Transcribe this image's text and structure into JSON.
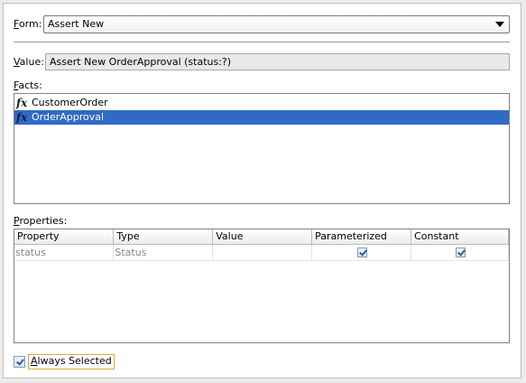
{
  "form": {
    "label_key": "F",
    "label_rest": "orm:",
    "selected": "Assert New"
  },
  "value": {
    "label_key": "V",
    "label_rest": "alue:",
    "text": "Assert New OrderApproval (status:?)"
  },
  "facts": {
    "label_key": "F",
    "label_rest": "acts:",
    "items": [
      {
        "label": "CustomerOrder",
        "icon": "function-icon",
        "selected": false
      },
      {
        "label": "OrderApproval",
        "icon": "function-icon",
        "selected": true
      }
    ]
  },
  "properties": {
    "label_key": "P",
    "label_rest": "roperties:",
    "columns": [
      "Property",
      "Type",
      "Value",
      "Parameterized",
      "Constant"
    ],
    "rows": [
      {
        "property": "status",
        "type": "Status",
        "value": "",
        "parameterized": true,
        "constant": true
      }
    ]
  },
  "always_selected": {
    "label_key": "A",
    "label_rest": "lways Selected",
    "checked": true
  },
  "colors": {
    "selection": "#316ac5",
    "focus_border": "#e8a33c"
  }
}
